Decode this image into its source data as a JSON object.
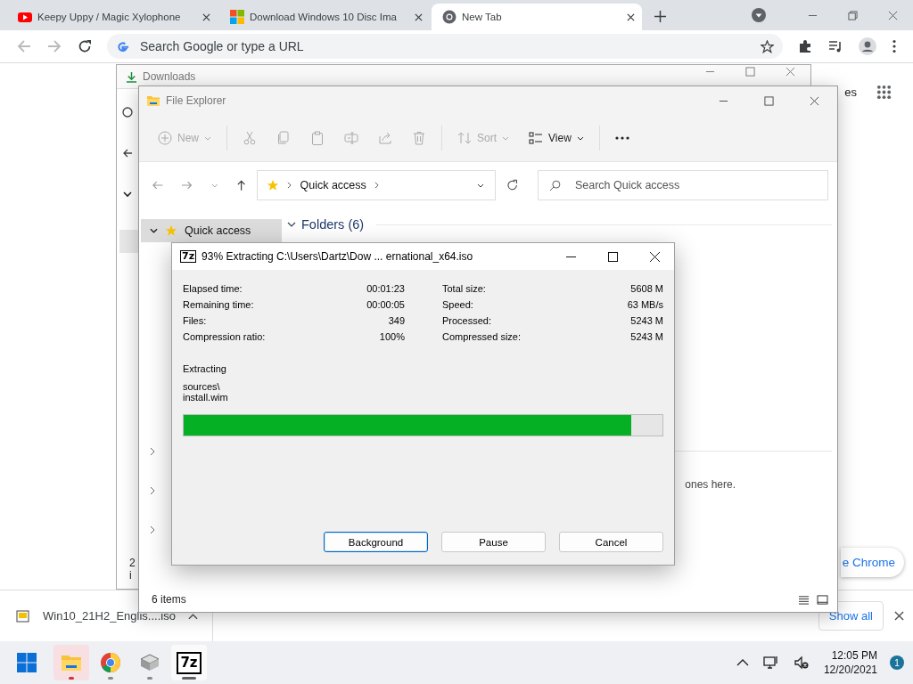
{
  "browser": {
    "tabs": [
      {
        "kind": "video",
        "title": "Keepy Uppy / Magic Xylophone",
        "selected": false
      },
      {
        "kind": "squares",
        "title": "Download Windows 10 Disc Ima",
        "selected": false
      },
      {
        "kind": "circle",
        "title": "New Tab",
        "selected": true
      }
    ],
    "omnibox": {
      "placeholder": "Search Google or type a URL"
    },
    "page_text": "es",
    "promo_button": "e Chrome"
  },
  "downloads_window": {
    "title": "Downloads",
    "status": "2 i"
  },
  "explorer": {
    "title": "File Explorer",
    "toolbar": [
      {
        "kind": "new",
        "label": "New",
        "disabled": true
      },
      {
        "kind": "cut",
        "disabled": true
      },
      {
        "kind": "copy",
        "disabled": true
      },
      {
        "kind": "paste",
        "disabled": true
      },
      {
        "kind": "rename",
        "disabled": true
      },
      {
        "kind": "share",
        "disabled": true
      },
      {
        "kind": "delete",
        "disabled": true
      },
      {
        "kind": "sort",
        "label": "Sort",
        "disabled": true
      },
      {
        "kind": "view",
        "label": "View",
        "disabled": false
      },
      {
        "kind": "more",
        "disabled": false
      }
    ],
    "address": "Quick access",
    "search": {
      "placeholder": "Search Quick access"
    },
    "nav": [
      {
        "label": "Quick access",
        "selected": true
      }
    ],
    "section": "Folders (6)",
    "hint": "ones here.",
    "status": "6 items"
  },
  "dialog": {
    "logo": "7z",
    "title": "93% Extracting C:\\Users\\Dartz\\Dow ... ernational_x64.iso",
    "stats_left": [
      {
        "label": "Elapsed time:",
        "value": "00:01:23"
      },
      {
        "label": "Remaining time:",
        "value": "00:00:05"
      },
      {
        "label": "Files:",
        "value": "349"
      },
      {
        "label": "Compression ratio:",
        "value": "100%"
      }
    ],
    "stats_right": [
      {
        "label": "Total size:",
        "value": "5608 M"
      },
      {
        "label": "Speed:",
        "value": "63 MB/s"
      },
      {
        "label": "Processed:",
        "value": "5243 M"
      },
      {
        "label": "Compressed size:",
        "value": "5243 M"
      }
    ],
    "operation": "Extracting",
    "path": "sources\\",
    "file": "install.wim",
    "progress": {
      "level": 0.935
    },
    "buttons": [
      {
        "label": "Background",
        "focused": true
      },
      {
        "label": "Pause",
        "focused": false
      },
      {
        "label": "Cancel",
        "focused": false
      }
    ]
  },
  "download_bar": {
    "items": [
      {
        "filename": "Win10_21H2_Englis....iso"
      }
    ],
    "show_all": "Show all"
  },
  "taskbar": {
    "apps": [
      {
        "kind": "folder",
        "running": true,
        "active": false,
        "flashing": true
      },
      {
        "kind": "circle",
        "running": true,
        "active": false,
        "flashing": false
      },
      {
        "kind": "device",
        "running": true,
        "active": false,
        "flashing": false
      },
      {
        "kind": "archiver",
        "label": "7z",
        "running": true,
        "active": true,
        "flashing": false
      }
    ],
    "time": "12:05 PM",
    "date": "12/20/2021",
    "notifications": "1"
  }
}
